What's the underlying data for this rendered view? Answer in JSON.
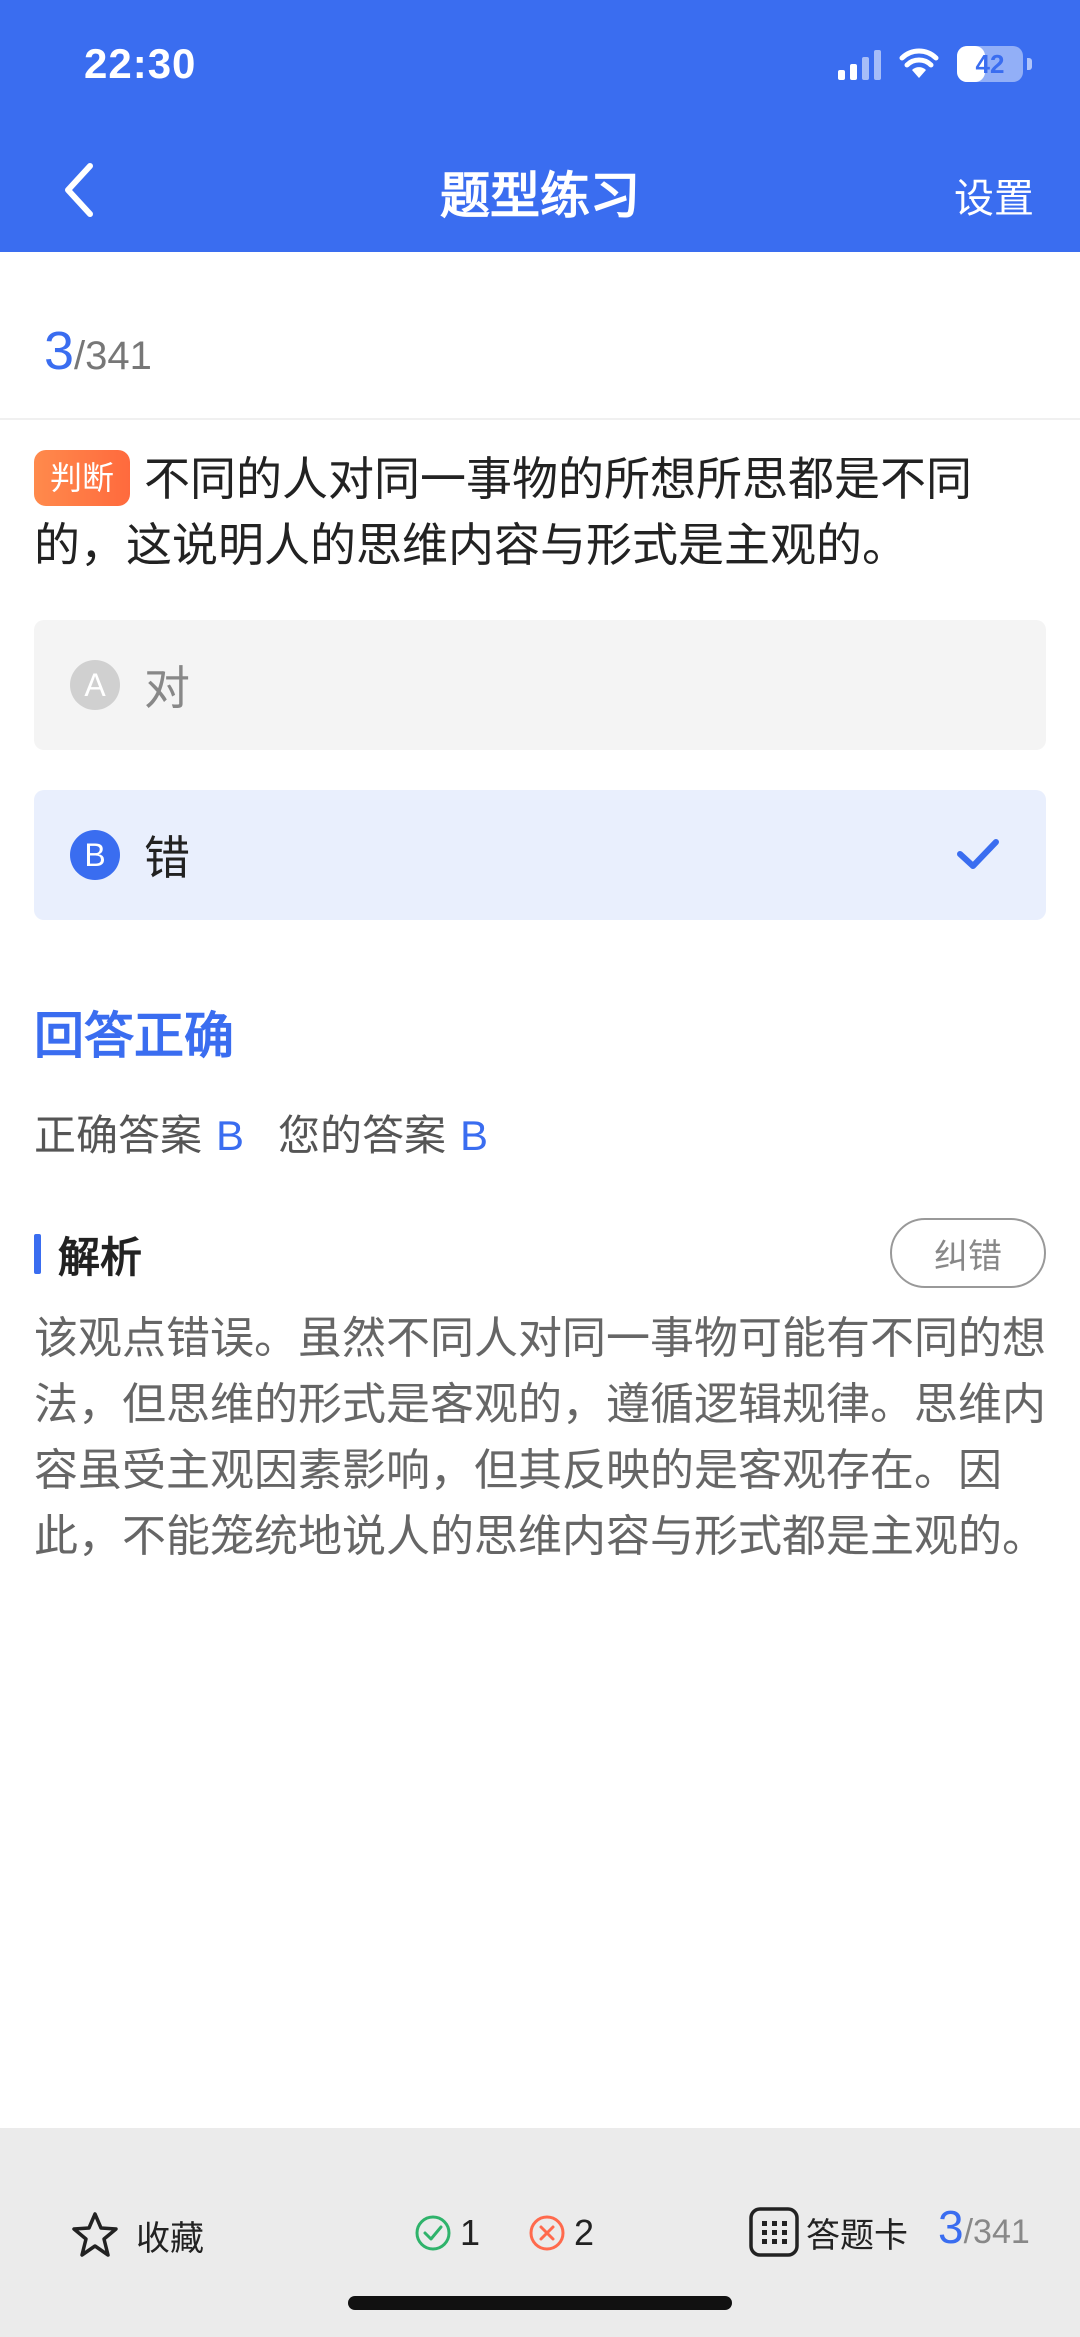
{
  "status_bar": {
    "time": "22:30",
    "battery": "42",
    "battery_level": 0.42
  },
  "nav": {
    "title": "题型练习",
    "settings_label": "设置"
  },
  "progress": {
    "current": "3",
    "total": "/341"
  },
  "question": {
    "type_tag": "判断",
    "text": "不同的人对同一事物的所想所思都是不同的，这说明人的思维内容与形式是主观的。",
    "options": [
      {
        "letter": "A",
        "text": "对",
        "selected": false
      },
      {
        "letter": "B",
        "text": "错",
        "selected": true
      }
    ]
  },
  "result": {
    "status": "回答正确",
    "correct_label": "正确答案",
    "correct_value": "B",
    "your_label": "您的答案",
    "your_value": "B"
  },
  "analysis": {
    "title": "解析",
    "report_label": "纠错",
    "text": "该观点错误。虽然不同人对同一事物可能有不同的想法，但思维的形式是客观的，遵循逻辑规律。思维内容虽受主观因素影响，但其反映的是客观存在。因此，不能笼统地说人的思维内容与形式都是主观的。"
  },
  "bottom": {
    "favorite_label": "收藏",
    "correct_count": "1",
    "wrong_count": "2",
    "answer_card_label": "答题卡",
    "current": "3",
    "total": "/341"
  },
  "colors": {
    "accent": "#3a6df0",
    "tag": "#ff7a45",
    "correct": "#2fb36b",
    "wrong": "#ff6a4d"
  }
}
